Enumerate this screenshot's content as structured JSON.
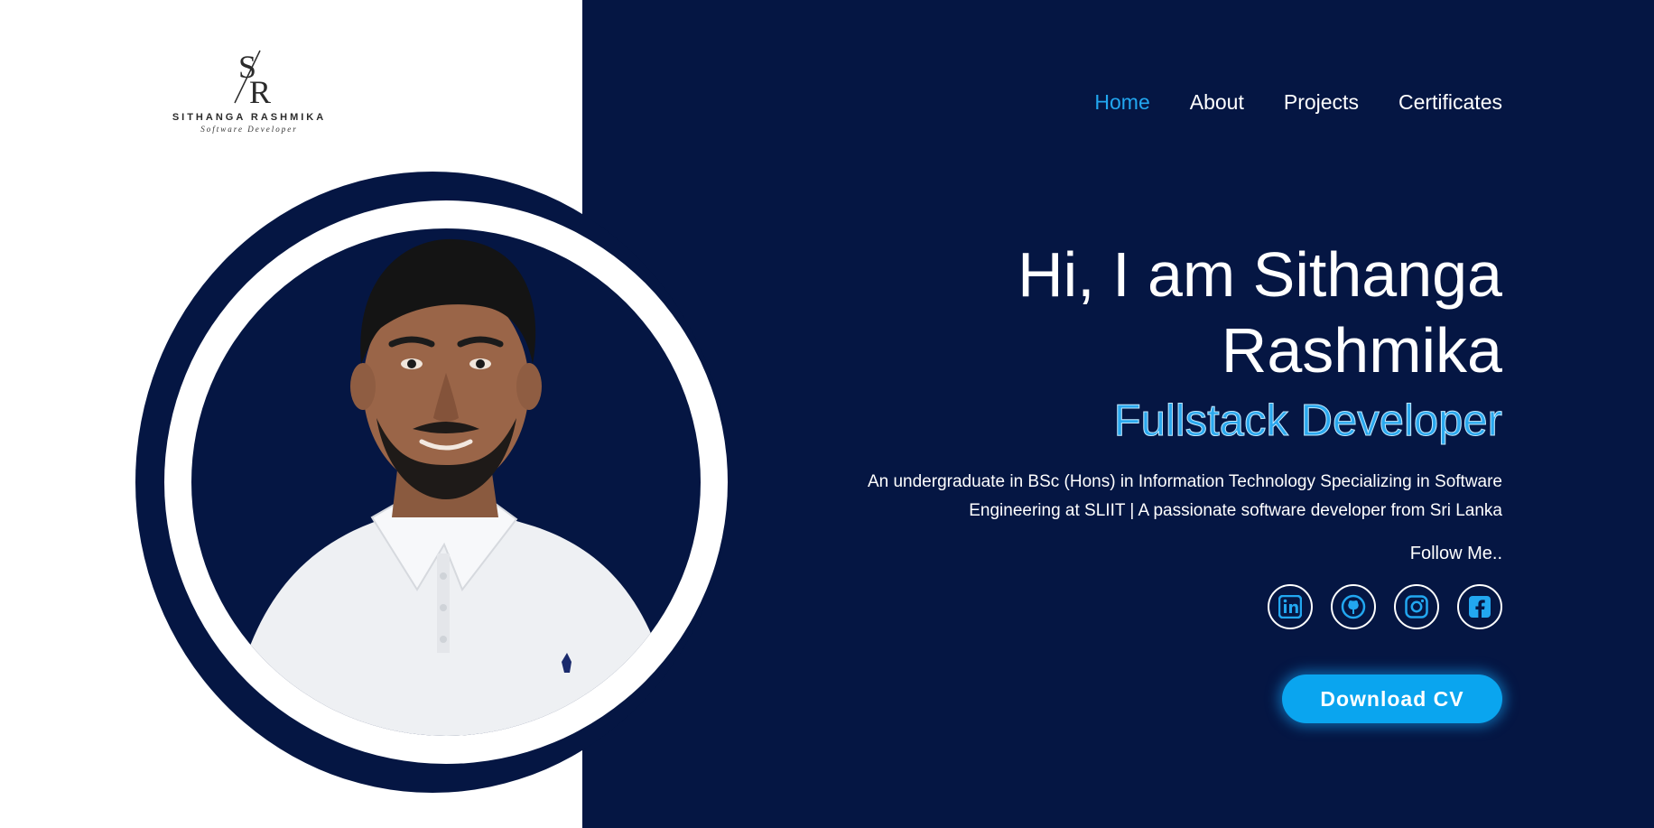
{
  "logo": {
    "monogram": "S/R",
    "name": "SITHANGA RASHMIKA",
    "subtitle": "Software Developer"
  },
  "nav": {
    "items": [
      {
        "label": "Home",
        "active": true
      },
      {
        "label": "About",
        "active": false
      },
      {
        "label": "Projects",
        "active": false
      },
      {
        "label": "Certificates",
        "active": false
      }
    ]
  },
  "hero": {
    "greeting_line1": "Hi, I am Sithanga",
    "greeting_line2": "Rashmika",
    "role": "Fullstack Developer",
    "description_line1": "An undergraduate in BSc (Hons) in Information Technology Specializing in Software",
    "description_line2": "Engineering at SLIIT | A passionate software developer from Sri Lanka",
    "follow_label": "Follow Me..",
    "cv_button": "Download CV"
  },
  "socials": [
    {
      "icon": "linkedin-icon"
    },
    {
      "icon": "github-icon"
    },
    {
      "icon": "instagram-icon"
    },
    {
      "icon": "facebook-icon"
    }
  ],
  "colors": {
    "navy": "#051643",
    "accent": "#0aa5ef",
    "active_nav": "#22a7f0",
    "white": "#ffffff"
  }
}
